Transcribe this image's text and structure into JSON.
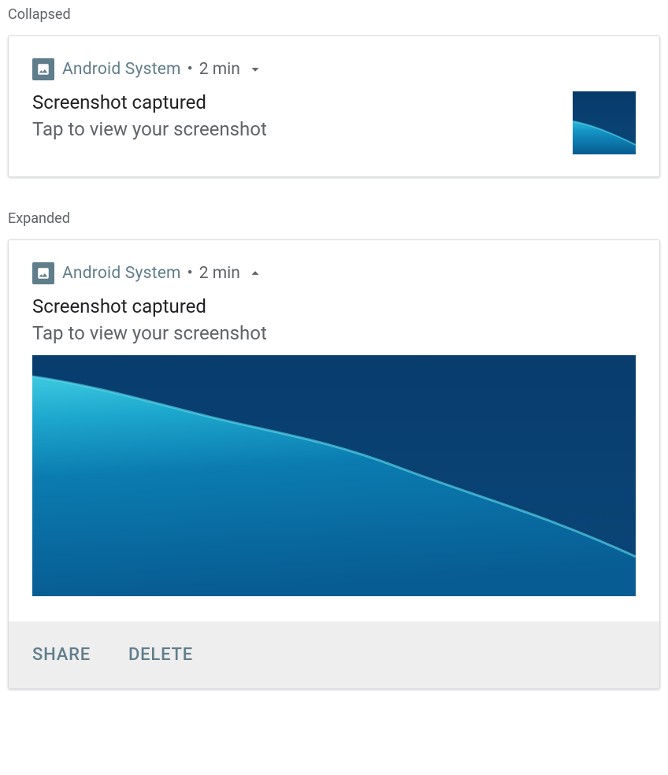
{
  "sections": {
    "collapsed_label": "Collapsed",
    "expanded_label": "Expanded"
  },
  "notification": {
    "app_name": "Android  System",
    "separator": "•",
    "timestamp": "2 min",
    "title": "Screenshot captured",
    "subtitle": "Tap to view your screenshot"
  },
  "actions": {
    "share": "Share",
    "delete": "Delete"
  },
  "icons": {
    "app_icon": "image-icon",
    "chevron_down": "chevron-down-icon",
    "chevron_up": "chevron-up-icon"
  },
  "colors": {
    "accent": "#607d8b",
    "text_primary": "#202124",
    "text_secondary": "#5f6368",
    "action_bg": "#eeeeee"
  }
}
